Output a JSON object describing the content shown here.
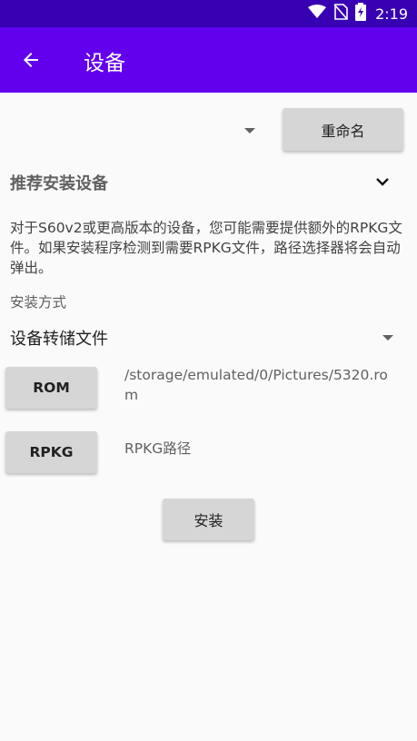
{
  "status_bar": {
    "time": "2:19",
    "icons": [
      "wifi-icon",
      "no-sim-icon",
      "battery-charging-icon"
    ],
    "color": "#3700b3"
  },
  "app_bar": {
    "title": "设备",
    "back_icon": "arrow-back-icon",
    "color": "#6200ee"
  },
  "device_selector": {
    "selected_value": "",
    "rename_label": "重命名"
  },
  "recommended": {
    "header": "推荐安装设备",
    "expand_icon": "chevron-down-icon",
    "description": "对于S60v2或更高版本的设备，您可能需要提供额外的RPKG文件。如果安装程序检测到需要RPKG文件，路径选择器将会自动弹出。"
  },
  "install_method": {
    "label": "安装方式",
    "selected": "设备转储文件"
  },
  "rom": {
    "button_label": "ROM",
    "path": "/storage/emulated/0/Pictures/5320.rom"
  },
  "rpkg": {
    "button_label": "RPKG",
    "path": "RPKG路径"
  },
  "install_label": "安装"
}
